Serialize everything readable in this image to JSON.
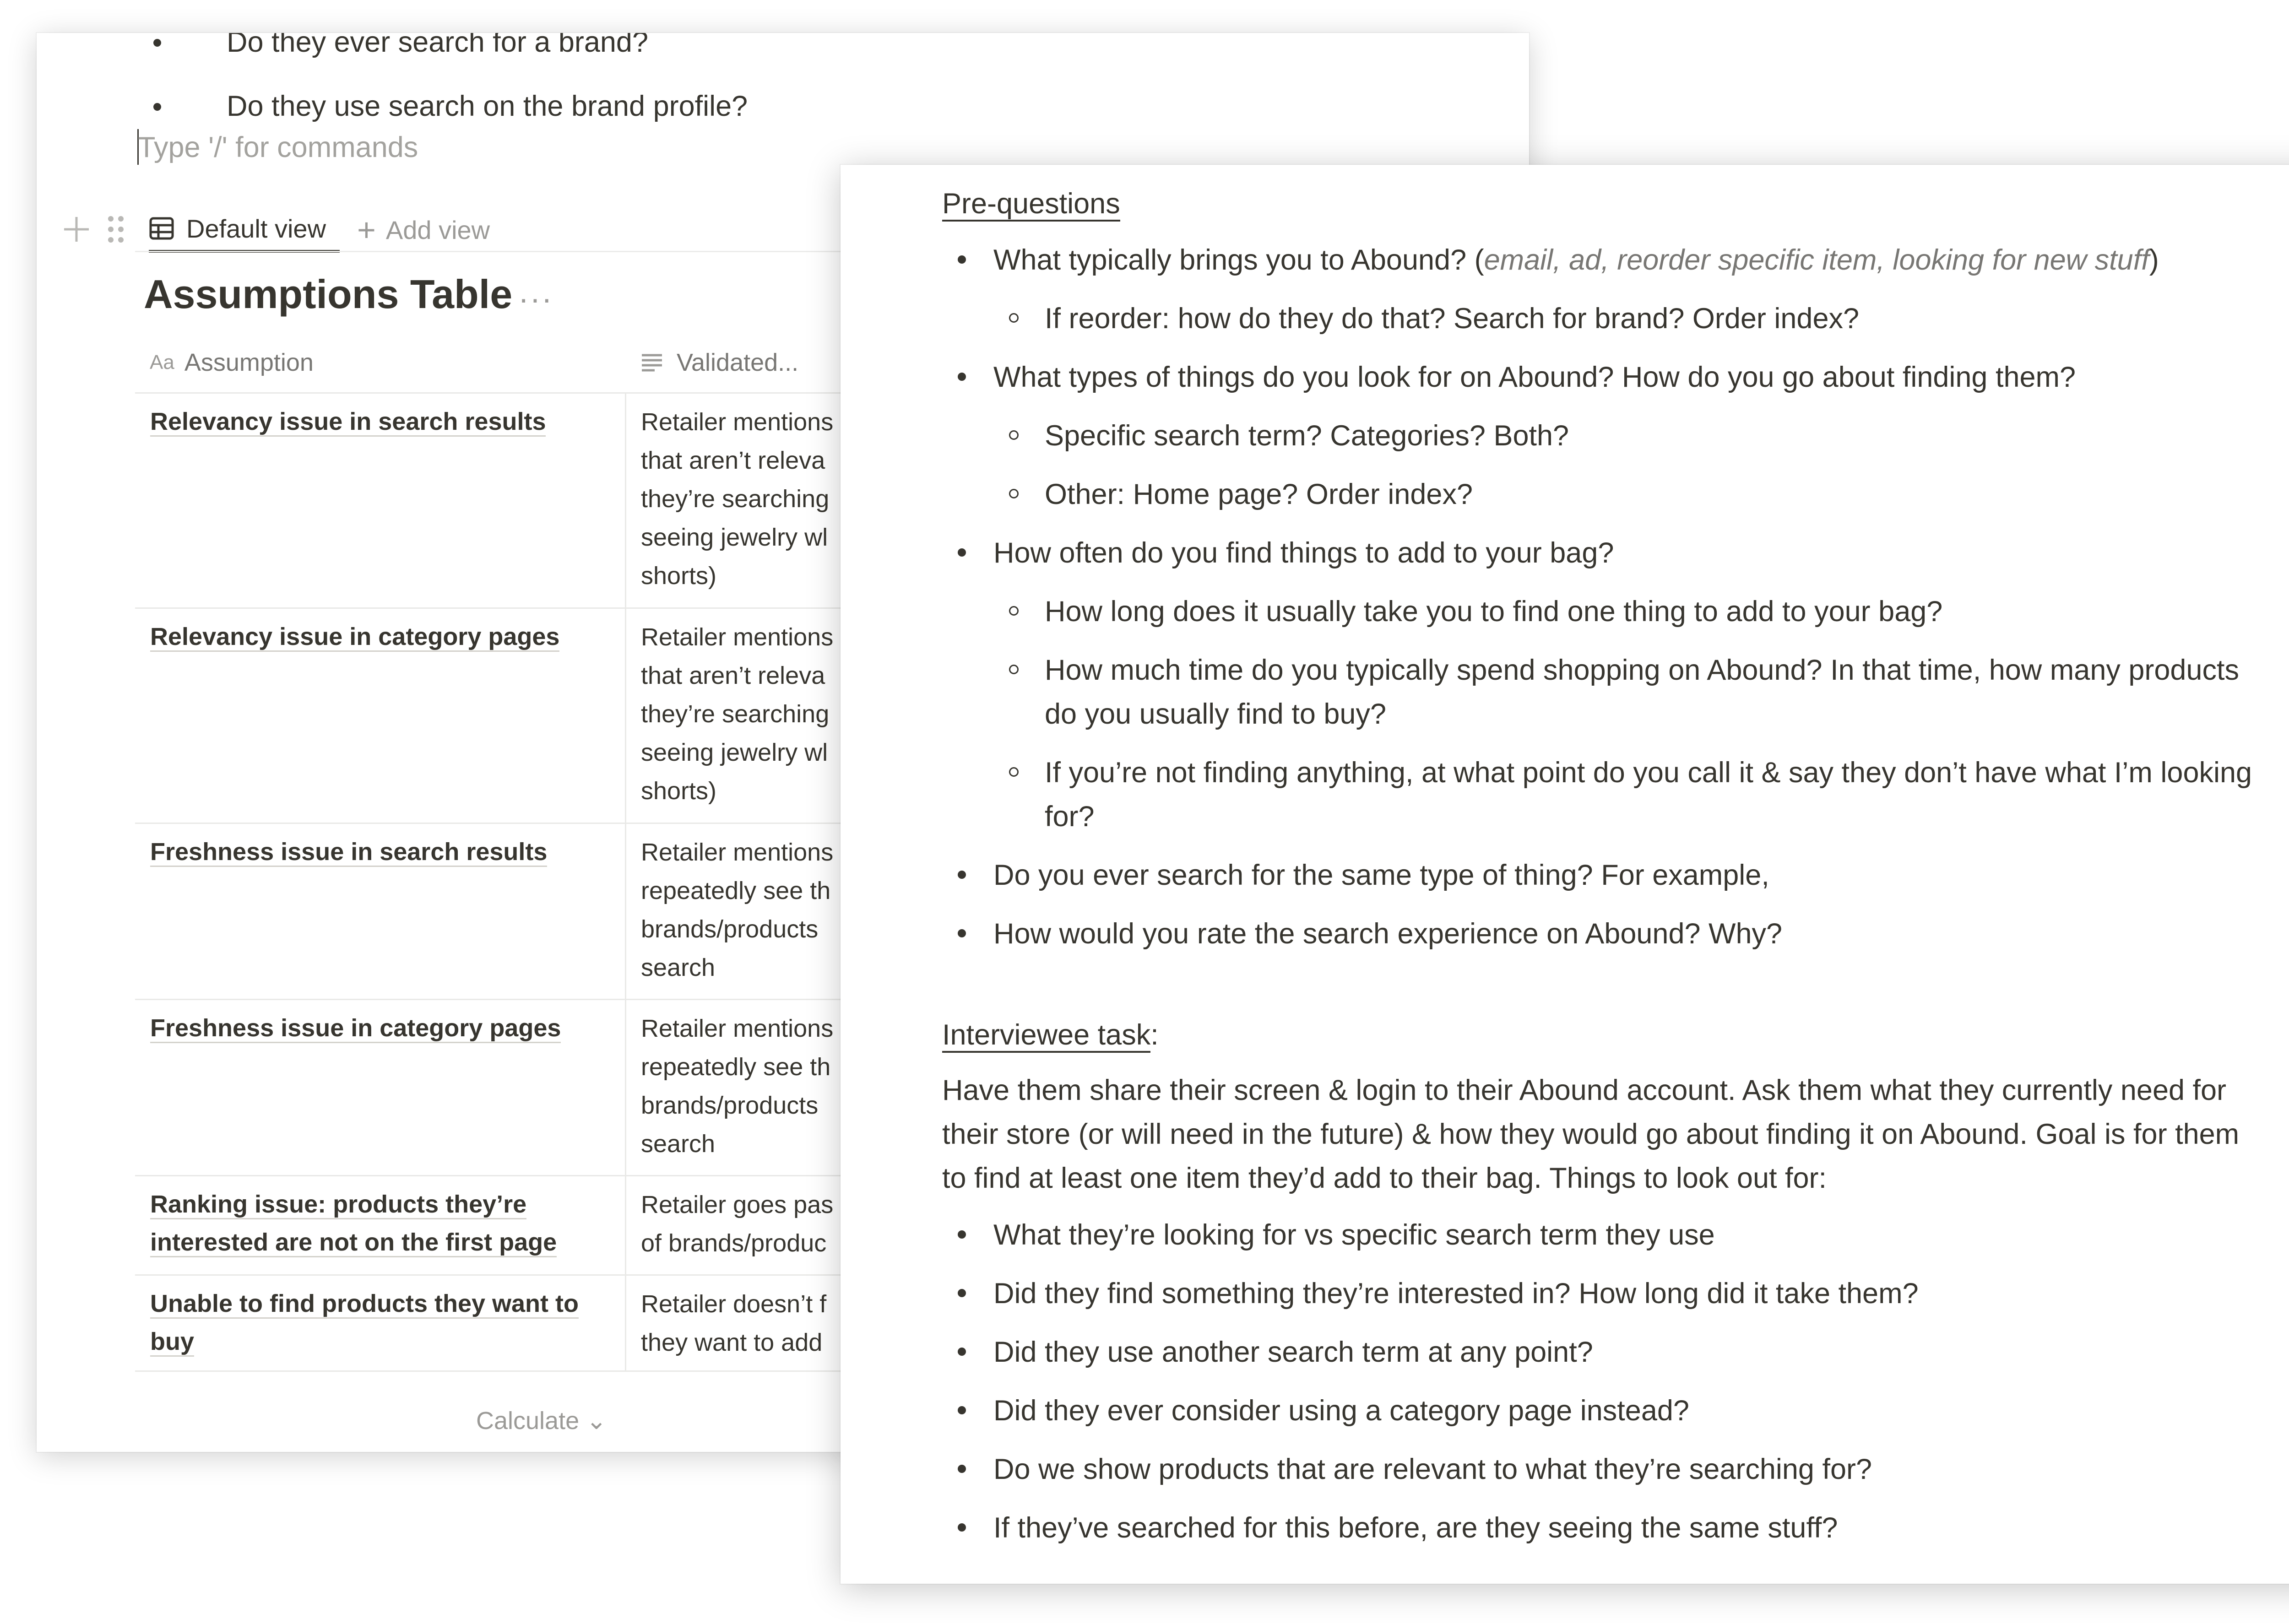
{
  "back_window": {
    "top_bullets": [
      "Do they ever search for a brand?",
      "Do they use search on the brand profile?"
    ],
    "command_placeholder": "Type '/' for commands",
    "views": {
      "default_view_label": "Default view",
      "add_view_label": "Add view"
    },
    "table": {
      "title": "Assumptions Table",
      "more_icon": "···",
      "columns": {
        "assumption_icon_text": "Aa",
        "assumption": "Assumption",
        "validated": "Validated..."
      },
      "rows": [
        {
          "name": "Relevancy issue in search results",
          "validated": "Retailer mentions\nthat aren’t releva\nthey’re searching\nseeing jewelry wl\nshorts)"
        },
        {
          "name": "Relevancy issue in category pages",
          "validated": "Retailer mentions\nthat aren’t releva\nthey’re searching\nseeing jewelry wl\nshorts)"
        },
        {
          "name": "Freshness issue in search results",
          "validated": "Retailer mentions\nrepeatedly see th\nbrands/products\nsearch"
        },
        {
          "name": "Freshness issue in category pages",
          "validated": "Retailer mentions\nrepeatedly see th\nbrands/products\nsearch"
        },
        {
          "name": "Ranking issue: products they’re interested are not on the first page",
          "validated": "Retailer goes pas\nof brands/produc"
        },
        {
          "name": "Unable to find products they want to buy",
          "validated": "Retailer doesn’t f\nthey want to add"
        }
      ],
      "calculate_label": "Calculate",
      "calculate_chevron": "⌄"
    }
  },
  "front_window": {
    "pre_questions": {
      "heading": "Pre-questions",
      "items": [
        {
          "text": "What typically brings you to Abound? ",
          "paren_open": "(",
          "aside": "email, ad, reorder specific item, looking for new stuff",
          "paren_close": ")",
          "sub": [
            "If reorder: how do they do that? Search for brand? Order index?"
          ]
        },
        {
          "text": "What types of things do you look for on Abound? How do you go about finding them?",
          "sub": [
            "Specific search term? Categories? Both?",
            "Other: Home page? Order index?"
          ]
        },
        {
          "text": "How often do you find things to add to your bag?",
          "sub": [
            "How long does it usually take you to find one thing to add to your bag?",
            "How much time do you typically spend shopping on Abound? In that time, how many products do you usually find to buy?",
            "If you’re not finding anything, at what point do you call it & say they don’t have what I’m looking for?"
          ]
        },
        {
          "text": "Do you ever search for the same type of thing? For example,"
        },
        {
          "text": "How would you rate the search experience on Abound? Why?"
        }
      ]
    },
    "interviewee_task": {
      "heading": "Interviewee task",
      "heading_suffix": ":",
      "description": "Have them share their screen & login to their Abound account. Ask them what they currently need for their store (or will need in the future) & how they would go about finding it on Abound. Goal is for them to find at least one item they’d add to their bag. Things to look out for:",
      "items": [
        "What they’re looking for vs specific search term they use",
        "Did they find something they’re interested in? How long did it take them?",
        "Did they use another search term at any point?",
        "Did they ever consider using a category page instead?",
        "Do we show products that are relevant to what they’re searching for?",
        "If they’ve searched for this before, are they seeing the same stuff?"
      ]
    }
  }
}
